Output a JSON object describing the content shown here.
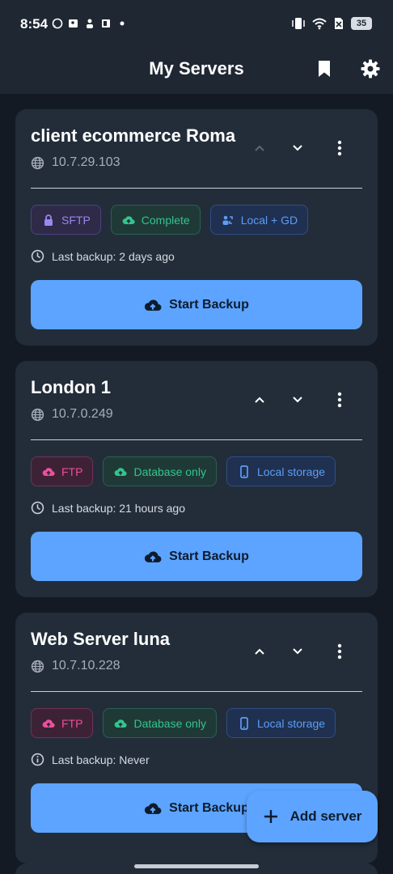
{
  "status_bar": {
    "time": "8:54",
    "battery": "35",
    "left_icons": [
      "whatsapp-icon",
      "contact-card-icon",
      "person-icon",
      "office-icon",
      "dot-icon"
    ],
    "right_icons": [
      "vibrate-icon",
      "wifi-icon",
      "no-sim-icon",
      "battery-icon"
    ]
  },
  "app_bar": {
    "title": "My Servers",
    "icons": [
      "bookmark-icon",
      "settings-icon"
    ]
  },
  "servers": [
    {
      "name": "client ecommerce Roma",
      "ip": "10.7.29.103",
      "chips": [
        {
          "label": "SFTP",
          "icon": "lock-icon",
          "color": "purple"
        },
        {
          "label": "Complete",
          "icon": "cloud-upload-icon",
          "color": "green"
        },
        {
          "label": "Local + GD",
          "icon": "sync-storage-icon",
          "color": "blue"
        }
      ],
      "last_backup": "Last backup: 2 days ago",
      "backup_icon": "clock-icon",
      "button_label": "Start Backup",
      "up_disabled": true
    },
    {
      "name": "London 1",
      "ip": "10.7.0.249",
      "chips": [
        {
          "label": "FTP",
          "icon": "cloud-upload-icon",
          "color": "pink"
        },
        {
          "label": "Database only",
          "icon": "cloud-upload-icon",
          "color": "green"
        },
        {
          "label": "Local storage",
          "icon": "phone-icon",
          "color": "blue"
        }
      ],
      "last_backup": "Last backup: 21 hours ago",
      "backup_icon": "clock-icon",
      "button_label": "Start Backup",
      "up_disabled": false
    },
    {
      "name": "Web Server luna",
      "ip": "10.7.10.228",
      "chips": [
        {
          "label": "FTP",
          "icon": "cloud-upload-icon",
          "color": "pink"
        },
        {
          "label": "Database only",
          "icon": "cloud-upload-icon",
          "color": "green"
        },
        {
          "label": "Local storage",
          "icon": "phone-icon",
          "color": "blue"
        }
      ],
      "last_backup": "Last backup: Never",
      "backup_icon": "info-icon",
      "button_label": "Start Backup",
      "up_disabled": false
    }
  ],
  "fab": {
    "label": "Add server",
    "icon": "plus-icon"
  },
  "colors": {
    "background": "#141a23",
    "card": "#232d3a",
    "accent": "#5ca4ff",
    "purple_chip": "#9b88f0",
    "green_chip": "#33c48e",
    "blue_chip": "#5c9ef5",
    "pink_chip": "#ee4f9a"
  }
}
